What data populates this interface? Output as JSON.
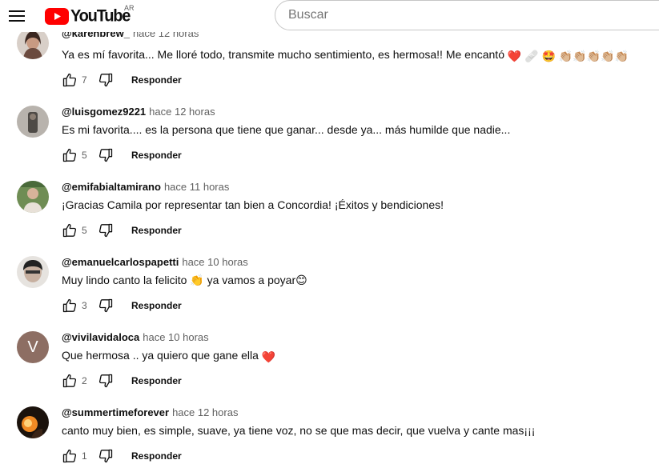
{
  "header": {
    "logo_text": "YouTube",
    "country_code": "AR",
    "search_placeholder": "Buscar",
    "brand_color": "#ff0000"
  },
  "reply_label": "Responder",
  "comments": [
    {
      "author": "@karenbrew_",
      "time": "hace 12 horas",
      "text": "Ya es mí favorita... Me lloré todo, transmite mucho sentimiento, es hermosa!! Me encantó",
      "emojis": "❤️ 🩹 🤩 👏🏼👏🏼👏🏼👏🏼👏🏼",
      "likes": "7"
    },
    {
      "author": "@luisgomez9221",
      "time": "hace 12 horas",
      "text": "Es mi favorita.... es la persona que tiene que ganar... desde ya... más humilde que nadie...",
      "emojis": "",
      "likes": "5"
    },
    {
      "author": "@emifabialtamirano",
      "time": "hace 11 horas",
      "text": "¡Gracias Camila por representar tan bien a Concordia! ¡Éxitos y bendiciones!",
      "emojis": "",
      "likes": "5"
    },
    {
      "author": "@emanuelcarlospapetti",
      "time": "hace 10 horas",
      "text": "Muy lindo canto la felicito 👏 ya vamos a poyar😊",
      "emojis": "",
      "likes": "3"
    },
    {
      "author": "@vivilavidaloca",
      "time": "hace 10 horas",
      "text": "Que hermosa .. ya quiero que gane ella",
      "emojis": "❤️",
      "likes": "2",
      "avatar_letter": "V"
    },
    {
      "author": "@summertimeforever",
      "time": "hace 12 horas",
      "text": "canto muy bien, es simple, suave, ya tiene voz, no se que mas decir, que vuelva y cante mas¡¡¡",
      "emojis": "",
      "likes": "1"
    }
  ]
}
